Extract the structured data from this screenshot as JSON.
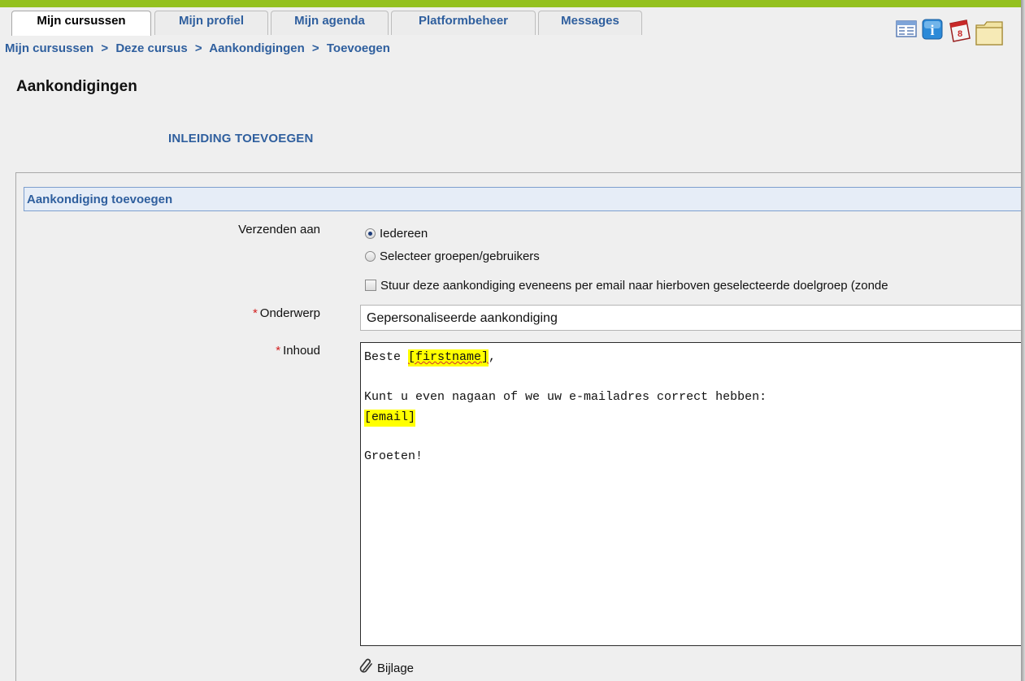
{
  "tabs": [
    {
      "label": "Mijn cursussen",
      "active": true
    },
    {
      "label": "Mijn profiel",
      "active": false
    },
    {
      "label": "Mijn agenda",
      "active": false
    },
    {
      "label": "Platformbeheer",
      "active": false
    },
    {
      "label": "Messages",
      "active": false
    }
  ],
  "top_icons": [
    "table-icon",
    "info-icon",
    "calendar-icon",
    "folder-icon"
  ],
  "breadcrumb": [
    "Mijn cursussen",
    "Deze cursus",
    "Aankondigingen",
    "Toevoegen"
  ],
  "breadcrumb_separator": ">",
  "page_title": "Aankondigingen",
  "intro_link": "INLEIDING TOEVOEGEN",
  "form": {
    "header": "Aankondiging toevoegen",
    "send_to_label": "Verzenden aan",
    "radio_everyone": "Iedereen",
    "radio_select": "Selecteer groepen/gebruikers",
    "selected_recipient": "Iedereen",
    "email_checkbox_label": "Stuur deze aankondiging eveneens per email naar hierboven geselecteerde doelgroep (zonde",
    "email_checked": false,
    "required_mark": "*",
    "subject_label": "Onderwerp",
    "subject_value": "Gepersonaliseerde aankondiging",
    "content_label": "Inhoud",
    "content": {
      "line1_prefix": "Beste ",
      "firstname_tag": "[firstname]",
      "line1_suffix": ",",
      "line2": "Kunt u even nagaan of we uw e-mailadres correct hebben:",
      "email_tag": "[email]",
      "line3": "Groeten!"
    },
    "attachment_label": "Bijlage"
  },
  "colors": {
    "accent_green": "#94c11f",
    "link_blue": "#2f5f9e",
    "highlight_yellow": "#ffff00",
    "required_red": "#d21f1f"
  }
}
